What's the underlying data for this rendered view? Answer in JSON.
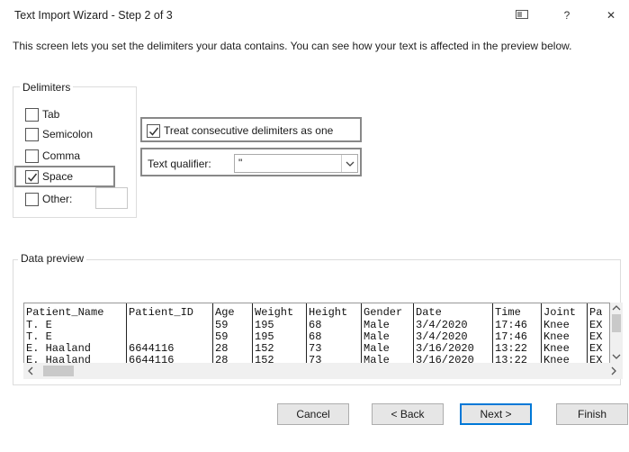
{
  "window": {
    "title": "Text Import Wizard - Step 2 of 3",
    "help_label": "?",
    "close_label": "✕"
  },
  "description": "This screen lets you set the delimiters your data contains.  You can see how your text is affected in the preview below.",
  "delimiters": {
    "legend": "Delimiters",
    "items": [
      {
        "label": "Tab",
        "checked": false
      },
      {
        "label": "Semicolon",
        "checked": false
      },
      {
        "label": "Comma",
        "checked": false
      },
      {
        "label": "Space",
        "checked": true
      },
      {
        "label": "Other:",
        "checked": false
      }
    ],
    "other_value": ""
  },
  "consecutive": {
    "label": "Treat consecutive delimiters as one",
    "checked": true
  },
  "text_qualifier": {
    "label": "Text qualifier:",
    "value": "\""
  },
  "preview": {
    "legend": "Data preview",
    "headers": [
      "Patient_Name",
      "Patient_ID",
      "Age",
      "Weight",
      "Height",
      "Gender",
      "Date",
      "Time",
      "Joint",
      "Pa"
    ],
    "rows": [
      [
        "T. E",
        "",
        "59",
        "195",
        "68",
        "Male",
        "3/4/2020",
        "17:46",
        "Knee",
        "EX"
      ],
      [
        "T. E",
        "",
        "59",
        "195",
        "68",
        "Male",
        "3/4/2020",
        "17:46",
        "Knee",
        "EX"
      ],
      [
        "E. Haaland",
        "6644116",
        "28",
        "152",
        "73",
        "Male",
        "3/16/2020",
        "13:22",
        "Knee",
        "EX"
      ],
      [
        "E. Haaland",
        "6644116",
        "28",
        "152",
        "73",
        "Male",
        "3/16/2020",
        "13:22",
        "Knee",
        "EX"
      ]
    ]
  },
  "buttons": {
    "cancel": "Cancel",
    "back": "< Back",
    "next": "Next >",
    "finish": "Finish"
  }
}
